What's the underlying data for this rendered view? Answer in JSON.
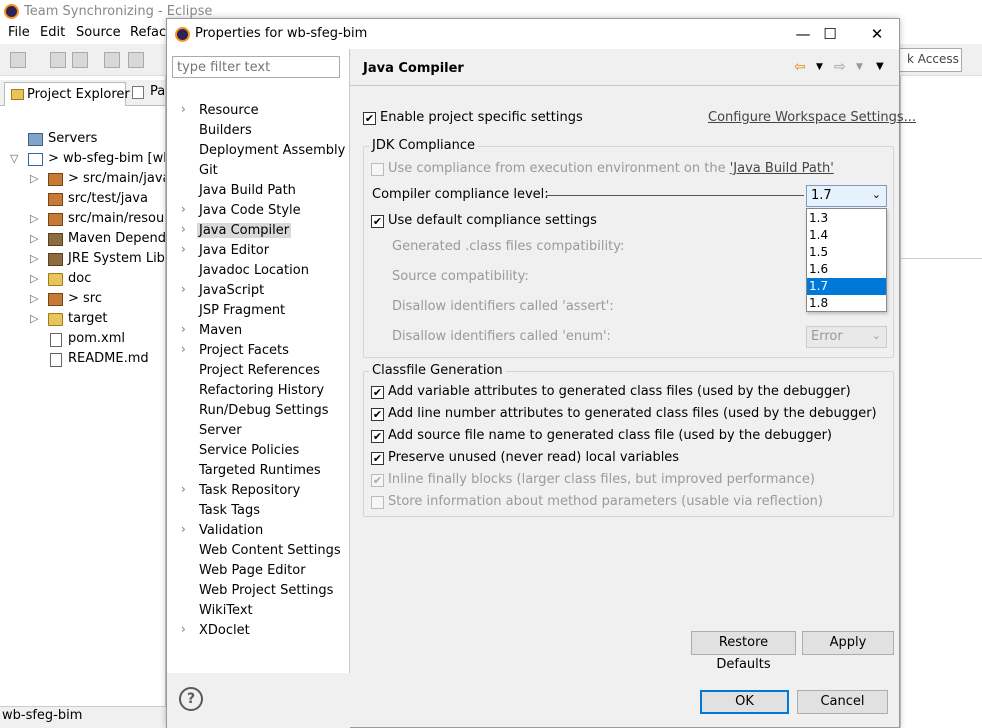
{
  "bg_window": {
    "title": "Team Synchronizing - Eclipse",
    "menu": [
      "File",
      "Edit",
      "Source",
      "Refact"
    ],
    "quick_access": "k Access",
    "explorer_tab": "Project Explorer",
    "second_tab": "Pa",
    "tree": [
      {
        "label": "Servers",
        "icon": "server-folder-icon"
      },
      {
        "label": "> wb-sfeg-bim  [wb",
        "icon": "project-icon"
      },
      {
        "label": "> src/main/java",
        "icon": "package-folder-icon"
      },
      {
        "label": "src/test/java",
        "icon": "package-folder-icon"
      },
      {
        "label": "src/main/resourc",
        "icon": "package-folder-icon"
      },
      {
        "label": "Maven Depende",
        "icon": "library-icon"
      },
      {
        "label": "JRE System Libra",
        "icon": "library-icon"
      },
      {
        "label": "doc",
        "icon": "folder-icon"
      },
      {
        "label": "> src",
        "icon": "folder-icon"
      },
      {
        "label": "target",
        "icon": "folder-icon"
      },
      {
        "label": "pom.xml",
        "icon": "xml-file-icon"
      },
      {
        "label": "README.md",
        "icon": "text-file-icon"
      }
    ],
    "status": "wb-sfeg-bim"
  },
  "dialog": {
    "title": "Properties for wb-sfeg-bim",
    "filter_placeholder": "type filter text",
    "nav": [
      "Resource",
      "Builders",
      "Deployment Assembly",
      "Git",
      "Java Build Path",
      "Java Code Style",
      "Java Compiler",
      "Java Editor",
      "Javadoc Location",
      "JavaScript",
      "JSP Fragment",
      "Maven",
      "Project Facets",
      "Project References",
      "Refactoring History",
      "Run/Debug Settings",
      "Server",
      "Service Policies",
      "Targeted Runtimes",
      "Task Repository",
      "Task Tags",
      "Validation",
      "Web Content Settings",
      "Web Page Editor",
      "Web Project Settings",
      "WikiText",
      "XDoclet"
    ],
    "selected_nav": "Java Compiler",
    "page_title": "Java Compiler",
    "enable_specific": "Enable project specific settings",
    "configure_link": "Configure Workspace Settings...",
    "jdk_group": "JDK Compliance",
    "use_compliance_prefix": "Use compliance from execution environment on the ",
    "use_compliance_link": "'Java Build Path'",
    "compliance_label": "Compiler compliance level:",
    "compliance_value": "1.7",
    "compliance_options": [
      "1.3",
      "1.4",
      "1.5",
      "1.6",
      "1.7",
      "1.8"
    ],
    "use_default": "Use default compliance settings",
    "gen_class_label": "Generated .class files compatibility:",
    "source_compat_label": "Source compatibility:",
    "assert_label": "Disallow identifiers called 'assert':",
    "enum_label": "Disallow identifiers called 'enum':",
    "enum_value": "Error",
    "classfile_group": "Classfile Generation",
    "classfile_opts": [
      "Add variable attributes to generated class files (used by the debugger)",
      "Add line number attributes to generated class files (used by the debugger)",
      "Add source file name to generated class file (used by the debugger)",
      "Preserve unused (never read) local variables",
      "Inline finally blocks (larger class files, but improved performance)",
      "Store information about method parameters (usable via reflection)"
    ],
    "restore_defaults": "Restore Defaults",
    "apply": "Apply",
    "ok": "OK",
    "cancel": "Cancel",
    "help_glyph": "?"
  }
}
